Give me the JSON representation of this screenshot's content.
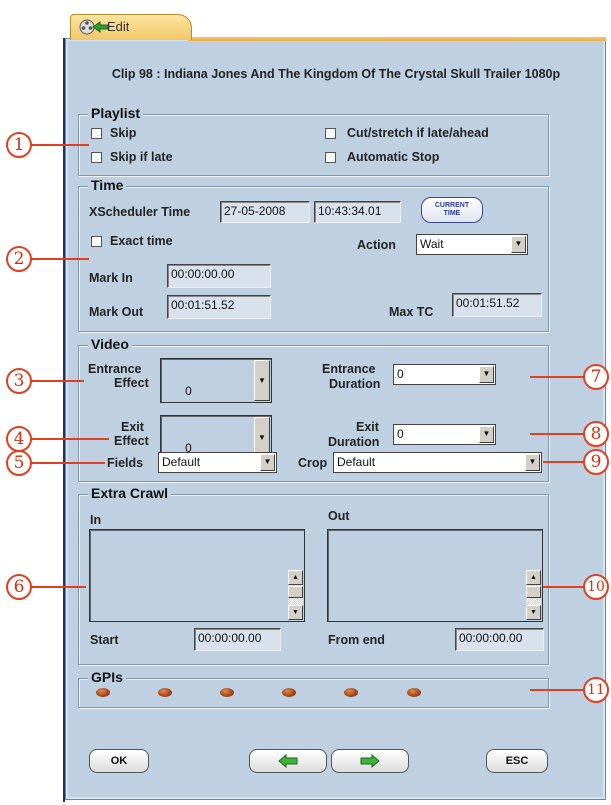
{
  "window": {
    "tab_label": "Edit",
    "title": "Clip 98 : Indiana Jones And The Kingdom Of The Crystal Skull Trailer 1080p"
  },
  "playlist": {
    "legend": "Playlist",
    "skip": "Skip",
    "skip_if_late": "Skip if late",
    "cut_stretch": "Cut/stretch if late/ahead",
    "automatic_stop": "Automatic Stop"
  },
  "time": {
    "legend": "Time",
    "xscheduler_label": "XScheduler Time",
    "date_value": "27-05-2008",
    "time_value": "10:43:34.01",
    "current_time_line1": "CURRENT",
    "current_time_line2": "TIME",
    "exact_time": "Exact time",
    "action_label": "Action",
    "action_value": "Wait",
    "mark_in_label": "Mark In",
    "mark_in_value": "00:00:00.00",
    "mark_out_label": "Mark Out",
    "mark_out_value": "00:01:51.52",
    "max_tc_label": "Max TC",
    "max_tc_value": "00:01:51.52"
  },
  "video": {
    "legend": "Video",
    "entrance_effect_l1": "Entrance",
    "entrance_effect_l2": "Effect",
    "entrance_effect_value": "0",
    "exit_effect_l1": "Exit",
    "exit_effect_l2": "Effect",
    "exit_effect_value": "0",
    "entrance_duration_l1": "Entrance",
    "entrance_duration_l2": "Duration",
    "entrance_duration_value": "0",
    "exit_duration_l1": "Exit",
    "exit_duration_l2": "Duration",
    "exit_duration_value": "0",
    "fields_label": "Fields",
    "fields_value": "Default",
    "crop_label": "Crop",
    "crop_value": "Default"
  },
  "extra_crawl": {
    "legend": "Extra Crawl",
    "in_label": "In",
    "out_label": "Out",
    "start_label": "Start",
    "start_value": "00:00:00.00",
    "from_end_label": "From end",
    "from_end_value": "00:00:00.00"
  },
  "gpis": {
    "legend": "GPIs",
    "count": 6
  },
  "buttons": {
    "ok": "OK",
    "esc": "ESC",
    "prev_icon": "left-arrow-icon",
    "next_icon": "right-arrow-icon"
  },
  "callouts": [
    "1",
    "2",
    "3",
    "4",
    "5",
    "6",
    "7",
    "8",
    "9",
    "10",
    "11"
  ],
  "colors": {
    "panel": "#bfd0e2",
    "tab": "#f2c768",
    "callout": "#e04020",
    "gpi": "#a0421a"
  }
}
